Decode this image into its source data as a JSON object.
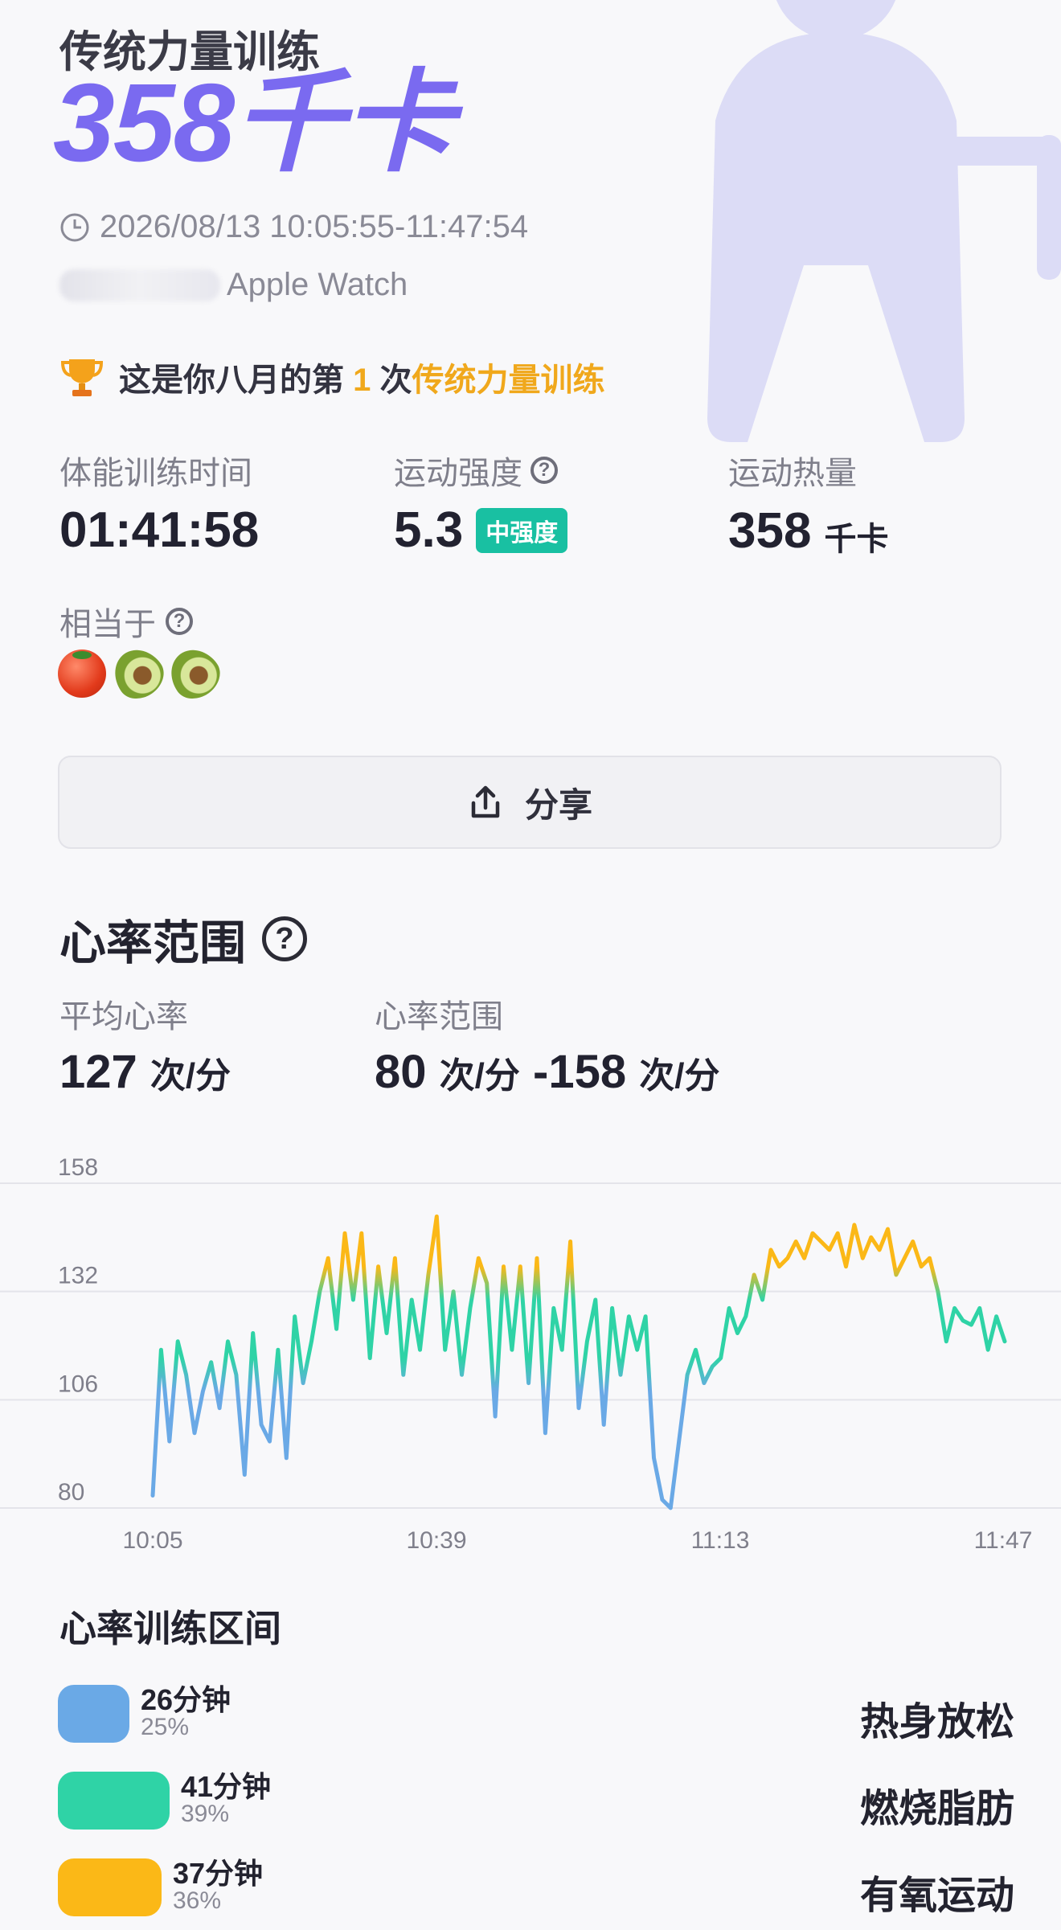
{
  "header": {
    "title": "传统力量训练",
    "kcal": "358千卡",
    "time_range": "2026/08/13 10:05:55-11:47:54",
    "device": "Apple Watch"
  },
  "achievement": {
    "prefix": "这是你八月的第",
    "count": "1",
    "mid": "次",
    "activity": "传统力量训练"
  },
  "stats": {
    "duration_label": "体能训练时间",
    "duration_value": "01:41:58",
    "intensity_label": "运动强度",
    "intensity_value": "5.3",
    "intensity_badge": "中强度",
    "calories_label": "运动热量",
    "calories_value": "358",
    "calories_unit": "千卡"
  },
  "equivalent": {
    "label": "相当于",
    "foods": [
      "tomato",
      "avocado",
      "avocado"
    ]
  },
  "share": {
    "label": "分享",
    "icon": "share-icon"
  },
  "heart": {
    "title": "心率范围",
    "avg_label": "平均心率",
    "avg_value": "127",
    "unit": "次/分",
    "range_label": "心率范围",
    "range_low": "80",
    "range_high": "158",
    "dash": "-"
  },
  "chart_data": {
    "type": "line",
    "y_ticks": [
      "158",
      "132",
      "106",
      "80"
    ],
    "x_ticks": [
      "10:05",
      "10:39",
      "11:13",
      "11:47"
    ],
    "ylim": [
      80,
      158
    ],
    "x": [
      0,
      1,
      2,
      3,
      4,
      5,
      6,
      7,
      8,
      9,
      10,
      11,
      12,
      13,
      14,
      15,
      16,
      17,
      18,
      19,
      20,
      21,
      22,
      23,
      24,
      25,
      26,
      27,
      28,
      29,
      30,
      31,
      32,
      33,
      34,
      35,
      36,
      37,
      38,
      39,
      40,
      41,
      42,
      43,
      44,
      45,
      46,
      47,
      48,
      49,
      50,
      51,
      52,
      53,
      54,
      55,
      56,
      57,
      58,
      59,
      60,
      61,
      62,
      63,
      64,
      65,
      66,
      67,
      68,
      69,
      70,
      71,
      72,
      73,
      74,
      75,
      76,
      77,
      78,
      79,
      80,
      81,
      82,
      83,
      84,
      85,
      86,
      87,
      88,
      89,
      90,
      91,
      92,
      93,
      94,
      95,
      96,
      97,
      98,
      99,
      100,
      101,
      102
    ],
    "values": [
      83,
      118,
      96,
      120,
      112,
      98,
      108,
      115,
      104,
      120,
      112,
      88,
      122,
      100,
      96,
      118,
      92,
      126,
      110,
      120,
      132,
      140,
      123,
      146,
      130,
      146,
      116,
      138,
      122,
      140,
      112,
      130,
      118,
      136,
      150,
      118,
      132,
      112,
      128,
      140,
      134,
      102,
      138,
      118,
      138,
      110,
      140,
      98,
      128,
      118,
      144,
      104,
      120,
      130,
      100,
      128,
      112,
      126,
      118,
      126,
      92,
      82,
      80,
      96,
      112,
      118,
      110,
      114,
      116,
      128,
      122,
      126,
      136,
      130,
      142,
      138,
      140,
      144,
      140,
      146,
      144,
      142,
      146,
      138,
      148,
      140,
      145,
      142,
      147,
      136,
      140,
      144,
      138,
      140,
      132,
      120,
      128,
      125,
      124,
      128,
      118,
      126,
      120
    ],
    "thresholds": {
      "warm": 124,
      "aerobic": 138,
      "peak": 152
    },
    "colors": {
      "low": "#6aa9e6",
      "mid": "#2fd3a6",
      "high": "#fbb817",
      "peak": "#f06a3b"
    }
  },
  "zones": {
    "title": "心率训练区间",
    "items": [
      {
        "minutes": "26分钟",
        "percent": "25%",
        "name": "热身放松",
        "color": "#6aa9e6",
        "fraction": 0.25
      },
      {
        "minutes": "41分钟",
        "percent": "39%",
        "name": "燃烧脂肪",
        "color": "#2fd3a6",
        "fraction": 0.39
      },
      {
        "minutes": "37分钟",
        "percent": "36%",
        "name": "有氧运动",
        "color": "#fbb817",
        "fraction": 0.36
      }
    ]
  }
}
